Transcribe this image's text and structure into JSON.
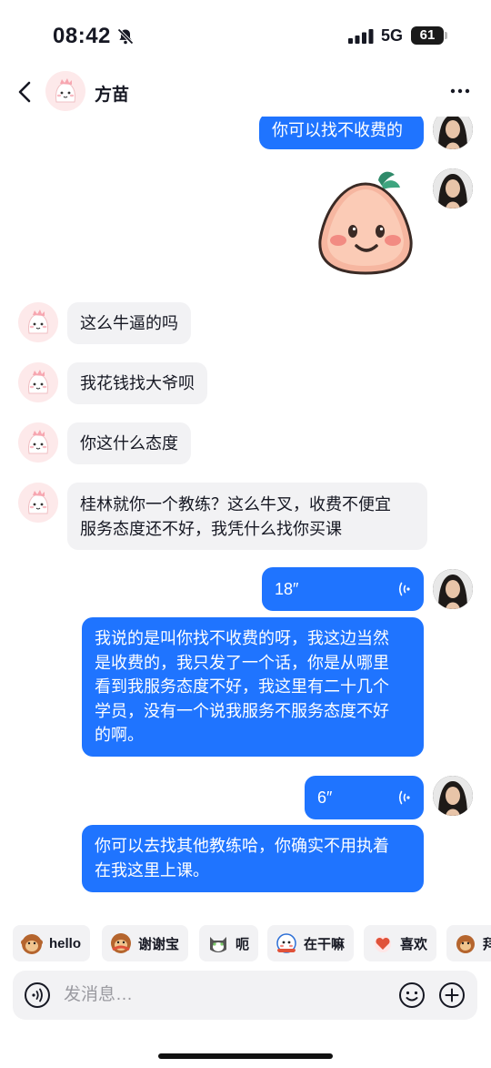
{
  "status_bar": {
    "time": "08:42",
    "network": "5G",
    "battery": "61",
    "icons": [
      "bell-slash-icon",
      "signal-bars-icon"
    ]
  },
  "header": {
    "contact_name": "方苗",
    "icons": [
      "back-chevron-icon",
      "more-dots-icon"
    ]
  },
  "messages": [
    {
      "side": "out",
      "type": "text",
      "text": "你可以找不收费的"
    },
    {
      "side": "out",
      "type": "sticker",
      "sticker": "smiling-peach-sticker"
    },
    {
      "side": "in",
      "type": "text",
      "text": "这么牛逼的吗"
    },
    {
      "side": "in",
      "type": "text",
      "text": "我花钱找大爷呗"
    },
    {
      "side": "in",
      "type": "text",
      "text": "你这什么态度"
    },
    {
      "side": "in",
      "type": "text",
      "lines": [
        "桂林就你一个教练？这么牛叉，收费不便宜",
        "服务态度还不好，我凭什么找你买课"
      ]
    },
    {
      "side": "out",
      "type": "voice",
      "duration": "18″"
    },
    {
      "side": "out",
      "type": "text",
      "lines": [
        "我说的是叫你找不收费的呀，我这边当然",
        "是收费的，我只发了一个话，你是从哪里",
        "看到我服务态度不好，我这里有二十几个",
        "学员，没有一个说我服务不服务态度不好",
        "的啊。"
      ]
    },
    {
      "side": "out",
      "type": "voice",
      "duration": "6″"
    },
    {
      "side": "out",
      "type": "text",
      "lines": [
        "你可以去找其他教练哈，你确实不用执着",
        "在我这里上课。"
      ]
    }
  ],
  "quick_replies": [
    {
      "label": "hello",
      "icon": "monkey-emoji-icon"
    },
    {
      "label": "谢谢宝",
      "icon": "monkey-hug-emoji-icon"
    },
    {
      "label": "呃",
      "icon": "cat-emoji-icon"
    },
    {
      "label": "在干嘛",
      "icon": "peeking-emoji-icon"
    },
    {
      "label": "喜欢",
      "icon": "heart-emoji-icon"
    },
    {
      "label": "拜",
      "icon": "monkey-wave-emoji-icon"
    }
  ],
  "input": {
    "placeholder": "发消息…",
    "icons": [
      "voice-wave-icon",
      "smiley-icon",
      "plus-icon"
    ]
  },
  "colors": {
    "accent": "#1f74ff",
    "incoming_bubble": "#f2f2f4",
    "background": "#ffffff"
  }
}
